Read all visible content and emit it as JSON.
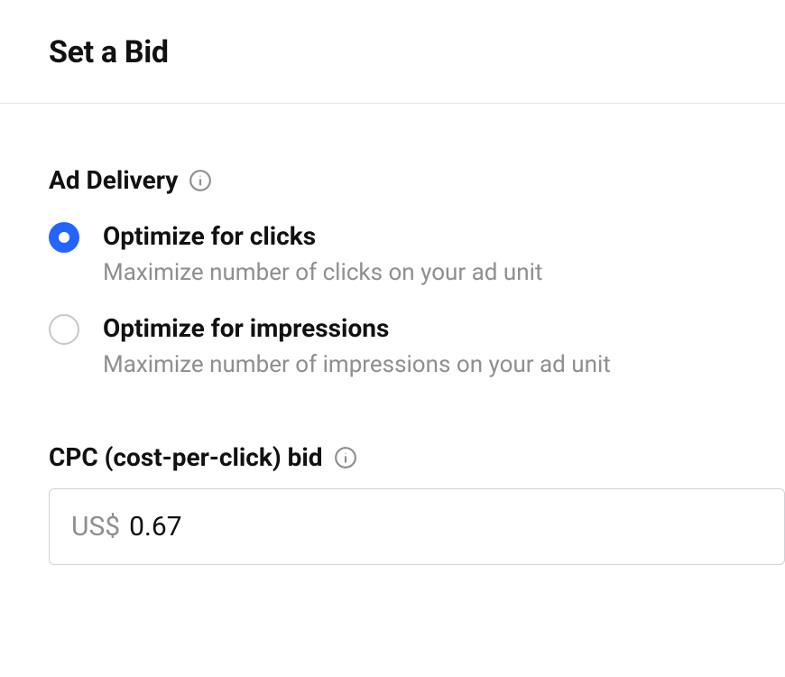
{
  "header": {
    "title": "Set a Bid"
  },
  "adDelivery": {
    "label": "Ad Delivery",
    "options": [
      {
        "title": "Optimize for clicks",
        "desc": "Maximize number of clicks on your ad unit",
        "selected": true
      },
      {
        "title": "Optimize for impressions",
        "desc": "Maximize number of impressions on your ad unit",
        "selected": false
      }
    ]
  },
  "cpc": {
    "label": "CPC (cost-per-click) bid",
    "currencyPrefix": "US$",
    "value": "0.67"
  }
}
